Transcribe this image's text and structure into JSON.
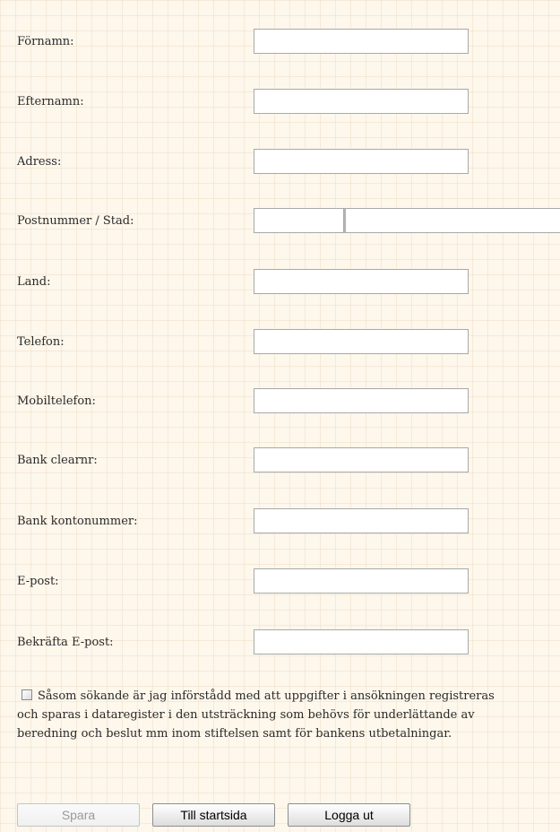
{
  "form": {
    "fields": [
      {
        "label": "Förnamn:",
        "value": ""
      },
      {
        "label": "Efternamn:",
        "value": ""
      },
      {
        "label": "Adress:",
        "value": ""
      },
      {
        "label": "Postnummer / Stad:",
        "zip_value": "",
        "city_value": ""
      },
      {
        "label": "Land:",
        "value": ""
      },
      {
        "label": "Telefon:",
        "value": ""
      },
      {
        "label": "Mobiltelefon:",
        "value": ""
      },
      {
        "label": "Bank clearnr:",
        "value": ""
      },
      {
        "label": "Bank kontonummer:",
        "value": ""
      },
      {
        "label": "E-post:",
        "value": ""
      },
      {
        "label": "Bekräfta E-post:",
        "value": ""
      }
    ],
    "consent": {
      "checked": false,
      "text": "Såsom sökande är jag införstådd med att uppgifter i ansökningen registreras och sparas i dataregister i den utsträckning som behövs för underlättande av beredning och beslut mm inom stiftelsen samt för bankens utbetalningar."
    }
  },
  "buttons": {
    "save": {
      "label": "Spara",
      "disabled": true
    },
    "home": {
      "label": "Till startsida"
    },
    "logout": {
      "label": "Logga ut"
    }
  },
  "colors": {
    "page_background": "#fdf7ec",
    "input_border": "#a9a9a9",
    "text": "#2a2a2a"
  }
}
